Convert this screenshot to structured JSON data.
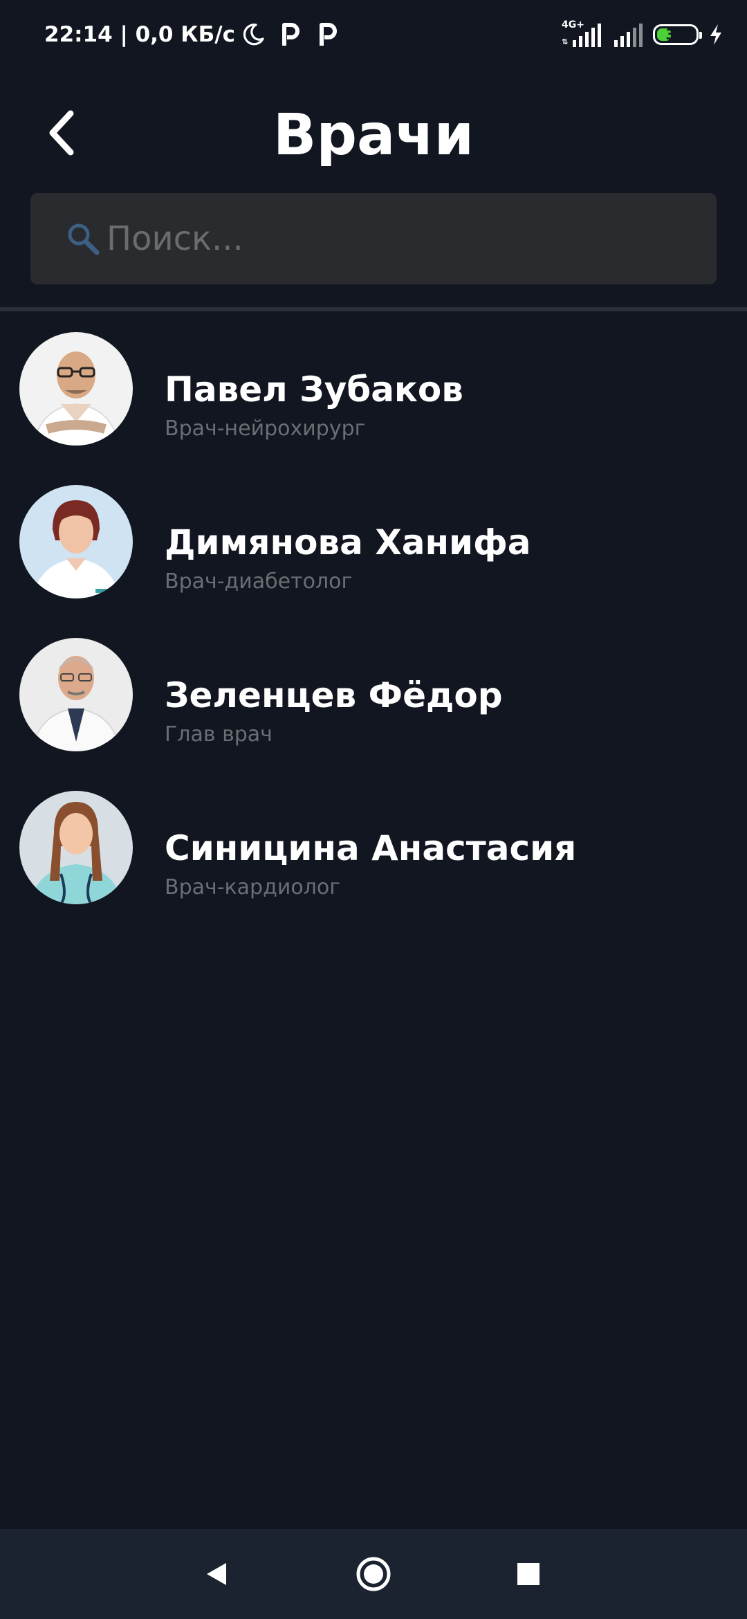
{
  "status_bar": {
    "time_speed": "22:14 | 0,0 КБ/с",
    "network_label": "4G+",
    "battery_level": "37",
    "battery_fraction": 0.37,
    "icons": [
      "moon-icon",
      "parking-icon",
      "parking-icon",
      "signal-4g-icon",
      "signal-icon",
      "battery-icon",
      "charging-icon"
    ]
  },
  "header": {
    "title": "Врачи",
    "back_icon": "chevron-left-icon"
  },
  "search": {
    "placeholder": "Поиск...",
    "value": "",
    "icon": "search-icon"
  },
  "doctors": [
    {
      "name": "Павел Зубаков",
      "specialty": "Врач-нейрохирург"
    },
    {
      "name": "Димянова Ханифа",
      "specialty": "Врач-диабетолог"
    },
    {
      "name": "Зеленцев Фёдор",
      "specialty": "Глав врач"
    },
    {
      "name": "Синицина Анастасия",
      "specialty": "Врач-кардиолог"
    }
  ],
  "nav_bar": {
    "icons": [
      "nav-back-icon",
      "nav-home-icon",
      "nav-recents-icon"
    ]
  },
  "colors": {
    "background": "#111620",
    "search_background": "#2a2b2e",
    "nav_background": "#1b2230",
    "secondary_text": "#6b6e73",
    "battery_green": "#4cd137",
    "search_icon": "#3d5f84"
  }
}
